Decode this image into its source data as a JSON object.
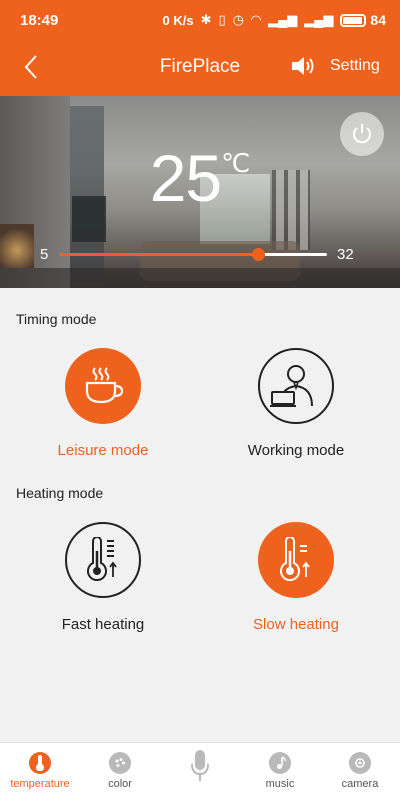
{
  "status_bar": {
    "time": "18:49",
    "net_speed": "0 K/s",
    "battery": "84"
  },
  "header": {
    "title": "FirePlace",
    "setting_label": "Setting"
  },
  "hero": {
    "temperature": "25",
    "unit": "℃",
    "slider_min": "5",
    "slider_max": "32",
    "slider_value": 25
  },
  "timing": {
    "label": "Timing mode",
    "modes": [
      {
        "label": "Leisure mode",
        "active": true
      },
      {
        "label": "Working mode",
        "active": false
      }
    ]
  },
  "heating": {
    "label": "Heating mode",
    "modes": [
      {
        "label": "Fast heating",
        "active": false
      },
      {
        "label": "Slow heating",
        "active": true
      }
    ]
  },
  "nav": {
    "items": [
      {
        "label": "temperature",
        "icon": "thermometer-icon",
        "active": true
      },
      {
        "label": "color",
        "icon": "palette-icon",
        "active": false
      },
      {
        "label": "",
        "icon": "microphone-icon",
        "active": false
      },
      {
        "label": "music",
        "icon": "music-note-icon",
        "active": false
      },
      {
        "label": "camera",
        "icon": "camera-icon",
        "active": false
      }
    ]
  },
  "colors": {
    "accent": "#ee621d",
    "text": "#222222",
    "background": "#f1f1f1"
  }
}
